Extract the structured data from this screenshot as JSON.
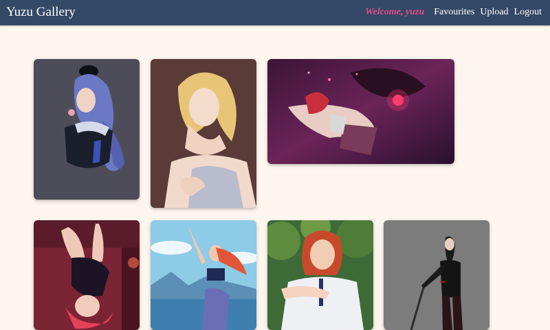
{
  "app": {
    "title": "Yuzu Gallery"
  },
  "nav": {
    "welcome": "Welcome, yuzu",
    "links": [
      "Favourites",
      "Upload",
      "Logout"
    ]
  },
  "colors": {
    "navbar": "#344966",
    "welcome": "#e44c8d",
    "page_background": "#fdf6ee"
  },
  "gallery": {
    "artworks": [
      {
        "subject": "blue-haired girl with fur collar"
      },
      {
        "subject": "blonde woman in silver dress"
      },
      {
        "subject": "red-haired girl with dragon"
      },
      {
        "subject": "upside-down red-haired girl"
      },
      {
        "subject": "red-haired girl by the sea"
      },
      {
        "subject": "red-haired girl in forest"
      },
      {
        "subject": "dark figure with weapon on grey"
      }
    ]
  }
}
